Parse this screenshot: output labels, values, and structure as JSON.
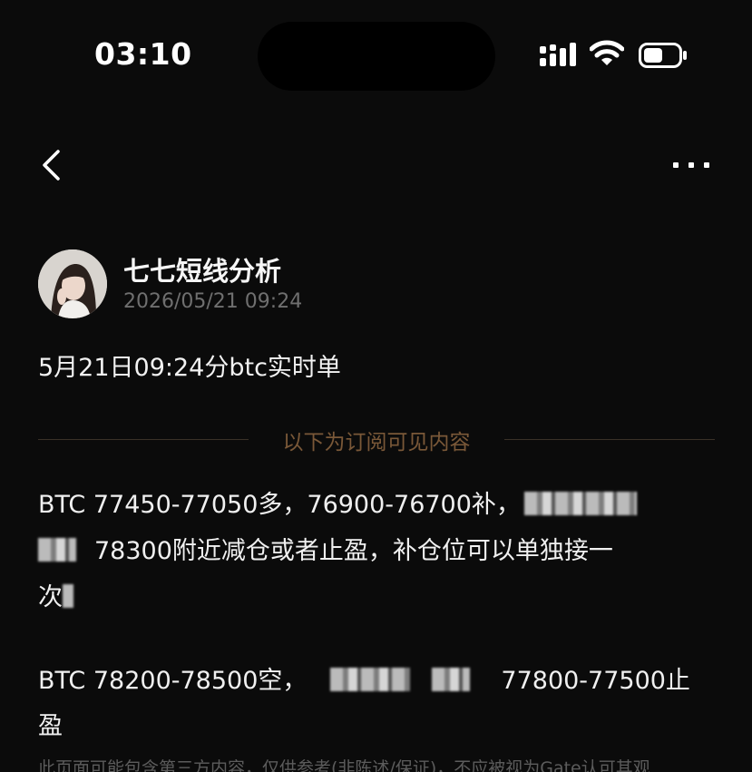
{
  "status_bar": {
    "time": "03:10"
  },
  "nav": {
    "back_icon": "chevron-left-icon",
    "more_icon": "more-dots-icon",
    "more_label": "···"
  },
  "author": {
    "name": "七七短线分析",
    "timestamp": "2026/05/21 09:24"
  },
  "post": {
    "title": "5月21日09:24分btc实时单",
    "divider_label": "以下为订阅可见内容",
    "lines": [
      "BTC 77450-77050多，76900-76700补，",
      "78300附近减仓或者止盈，补仓位可以单独接一",
      "次",
      "BTC 78200-78500空，",
      "77800-77500止",
      "盈"
    ],
    "disclaimer": "此页面可能包含第三方内容，仅供参考(非陈述/保证)，不应被视为Gate认可其观"
  },
  "colors": {
    "background": "#0b0b0b",
    "text": "#f2f2f2",
    "muted": "#6f6f6f",
    "accent_brown": "#7a5838"
  }
}
